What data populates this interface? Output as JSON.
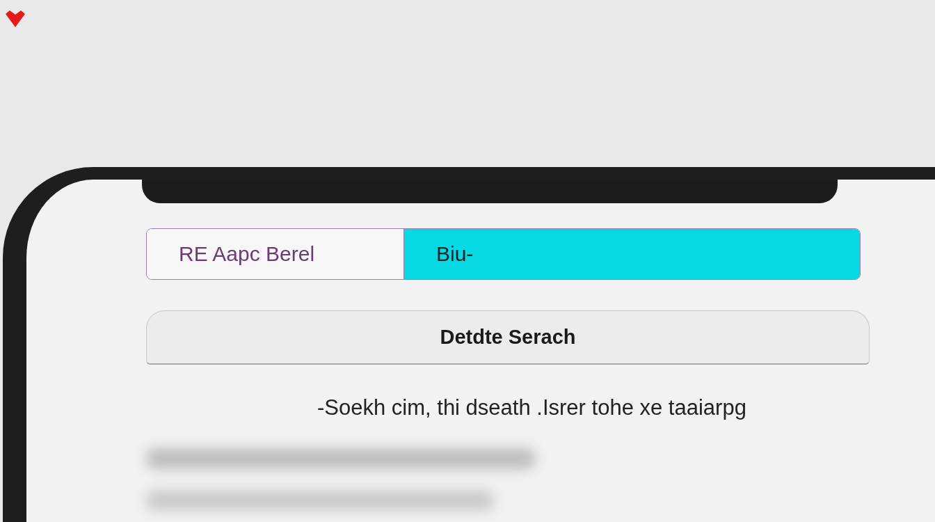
{
  "segments": [
    {
      "label": "RE Aapc Berel",
      "selected": false
    },
    {
      "label": "Biu-",
      "selected": true
    }
  ],
  "delete_button": {
    "label": "Detdte Serach"
  },
  "hint": "-Soekh cim, thi dseath .Isrer tohe xe taaiarpg"
}
